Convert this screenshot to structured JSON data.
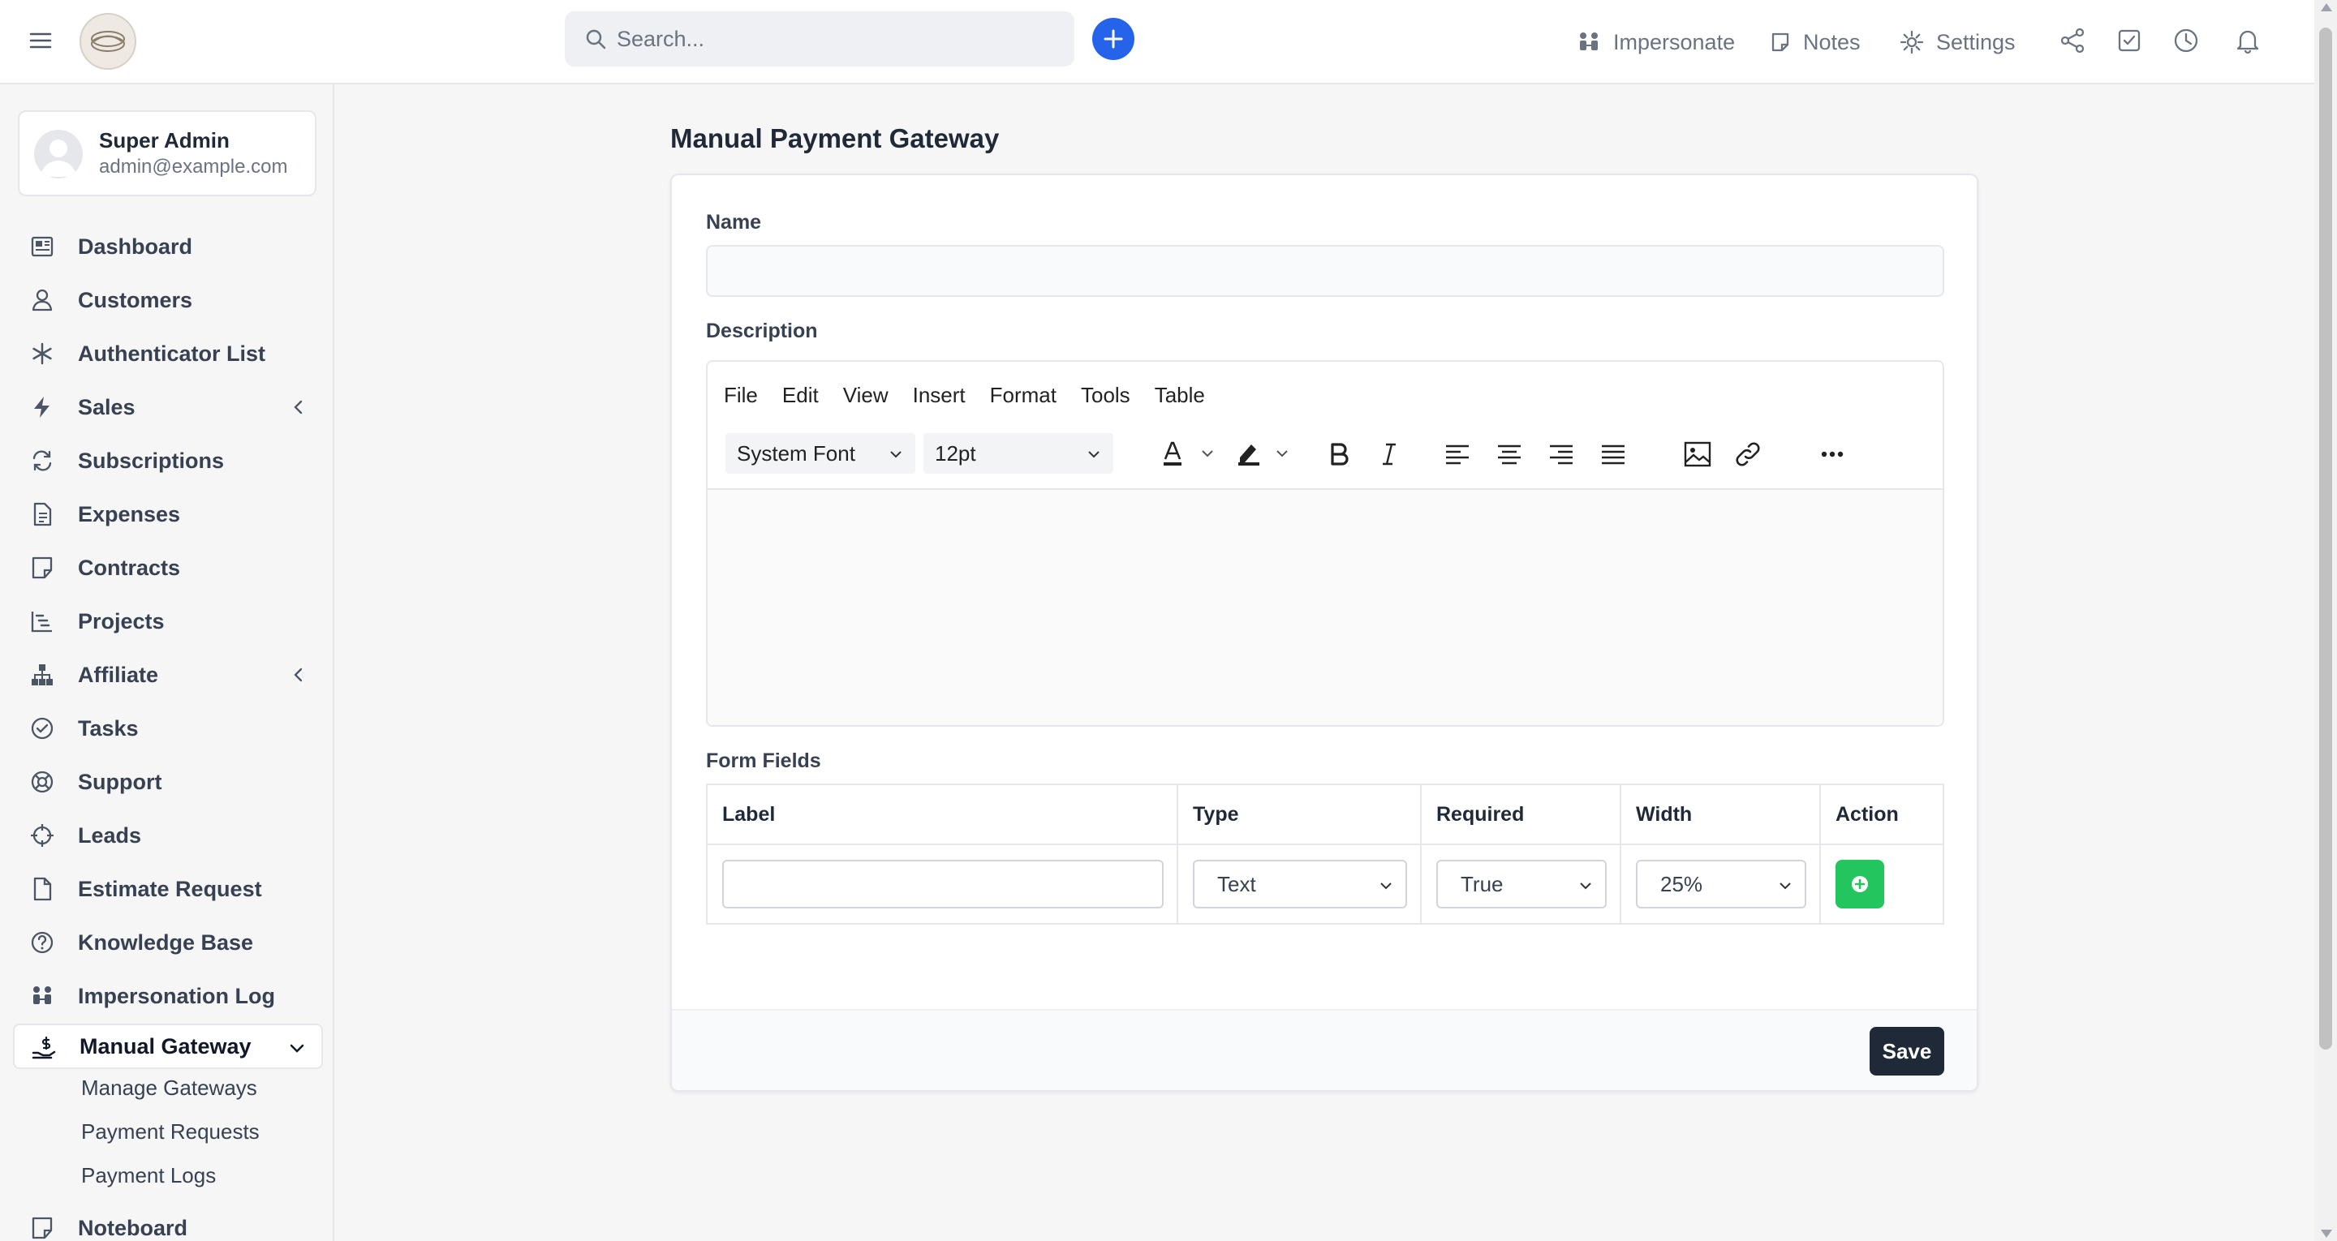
{
  "header": {
    "search_placeholder": "Search...",
    "links": {
      "impersonate": "Impersonate",
      "notes": "Notes",
      "settings": "Settings"
    }
  },
  "user": {
    "name": "Super Admin",
    "email": "admin@example.com"
  },
  "sidebar": {
    "items": [
      {
        "label": "Dashboard"
      },
      {
        "label": "Customers"
      },
      {
        "label": "Authenticator List"
      },
      {
        "label": "Sales"
      },
      {
        "label": "Subscriptions"
      },
      {
        "label": "Expenses"
      },
      {
        "label": "Contracts"
      },
      {
        "label": "Projects"
      },
      {
        "label": "Affiliate"
      },
      {
        "label": "Tasks"
      },
      {
        "label": "Support"
      },
      {
        "label": "Leads"
      },
      {
        "label": "Estimate Request"
      },
      {
        "label": "Knowledge Base"
      },
      {
        "label": "Impersonation Log"
      },
      {
        "label": "Manual Gateway"
      },
      {
        "label": "Noteboard"
      }
    ],
    "subitems": [
      {
        "label": "Manage Gateways"
      },
      {
        "label": "Payment Requests"
      },
      {
        "label": "Payment Logs"
      }
    ]
  },
  "page": {
    "title": "Manual Payment Gateway"
  },
  "form": {
    "name_label": "Name",
    "name_value": "",
    "description_label": "Description",
    "editor": {
      "menu": [
        "File",
        "Edit",
        "View",
        "Insert",
        "Format",
        "Tools",
        "Table"
      ],
      "font_family": "System Font",
      "font_size": "12pt"
    },
    "form_fields_label": "Form Fields",
    "table": {
      "headers": [
        "Label",
        "Type",
        "Required",
        "Width",
        "Action"
      ],
      "row": {
        "label_value": "",
        "type": "Text",
        "required": "True",
        "width": "25%"
      }
    },
    "save_label": "Save"
  },
  "colors": {
    "primary": "#2563eb",
    "success": "#22c55e",
    "dark": "#1f2937"
  }
}
